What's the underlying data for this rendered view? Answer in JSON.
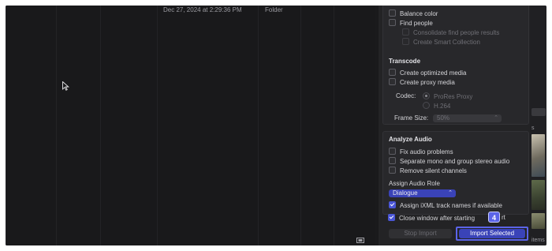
{
  "browser": {
    "header_date": "Dec 27, 2024 at 2:29:36 PM",
    "header_kind": "Folder"
  },
  "panel": {
    "analysis_top": {
      "balance_color": "Balance color",
      "find_people": "Find people",
      "consolidate": "Consolidate find people results",
      "smart_collection": "Create Smart Collection"
    },
    "transcode": {
      "heading": "Transcode",
      "optimized": "Create optimized media",
      "proxy": "Create proxy media",
      "codec_label": "Codec:",
      "codec_prores": "ProRes Proxy",
      "codec_h264": "H.264",
      "frame_size_label": "Frame Size:",
      "frame_size_value": "50%"
    },
    "audio": {
      "heading": "Analyze Audio",
      "fix": "Fix audio problems",
      "separate": "Separate mono and group stereo audio",
      "remove": "Remove silent channels",
      "role_heading": "Assign Audio Role",
      "role_value": "Dialogue",
      "ixml": "Assign iXML track names if available"
    },
    "close_window": "Close window after starting",
    "close_window_tail": "rt",
    "step_badge": "4",
    "stop_import": "Stop Import",
    "import_selected": "Import Selected"
  },
  "side": {
    "s_label": "s",
    "items_label": "items"
  },
  "colors": {
    "accent": "#4a56d6",
    "highlight_border": "#5b64e8"
  }
}
